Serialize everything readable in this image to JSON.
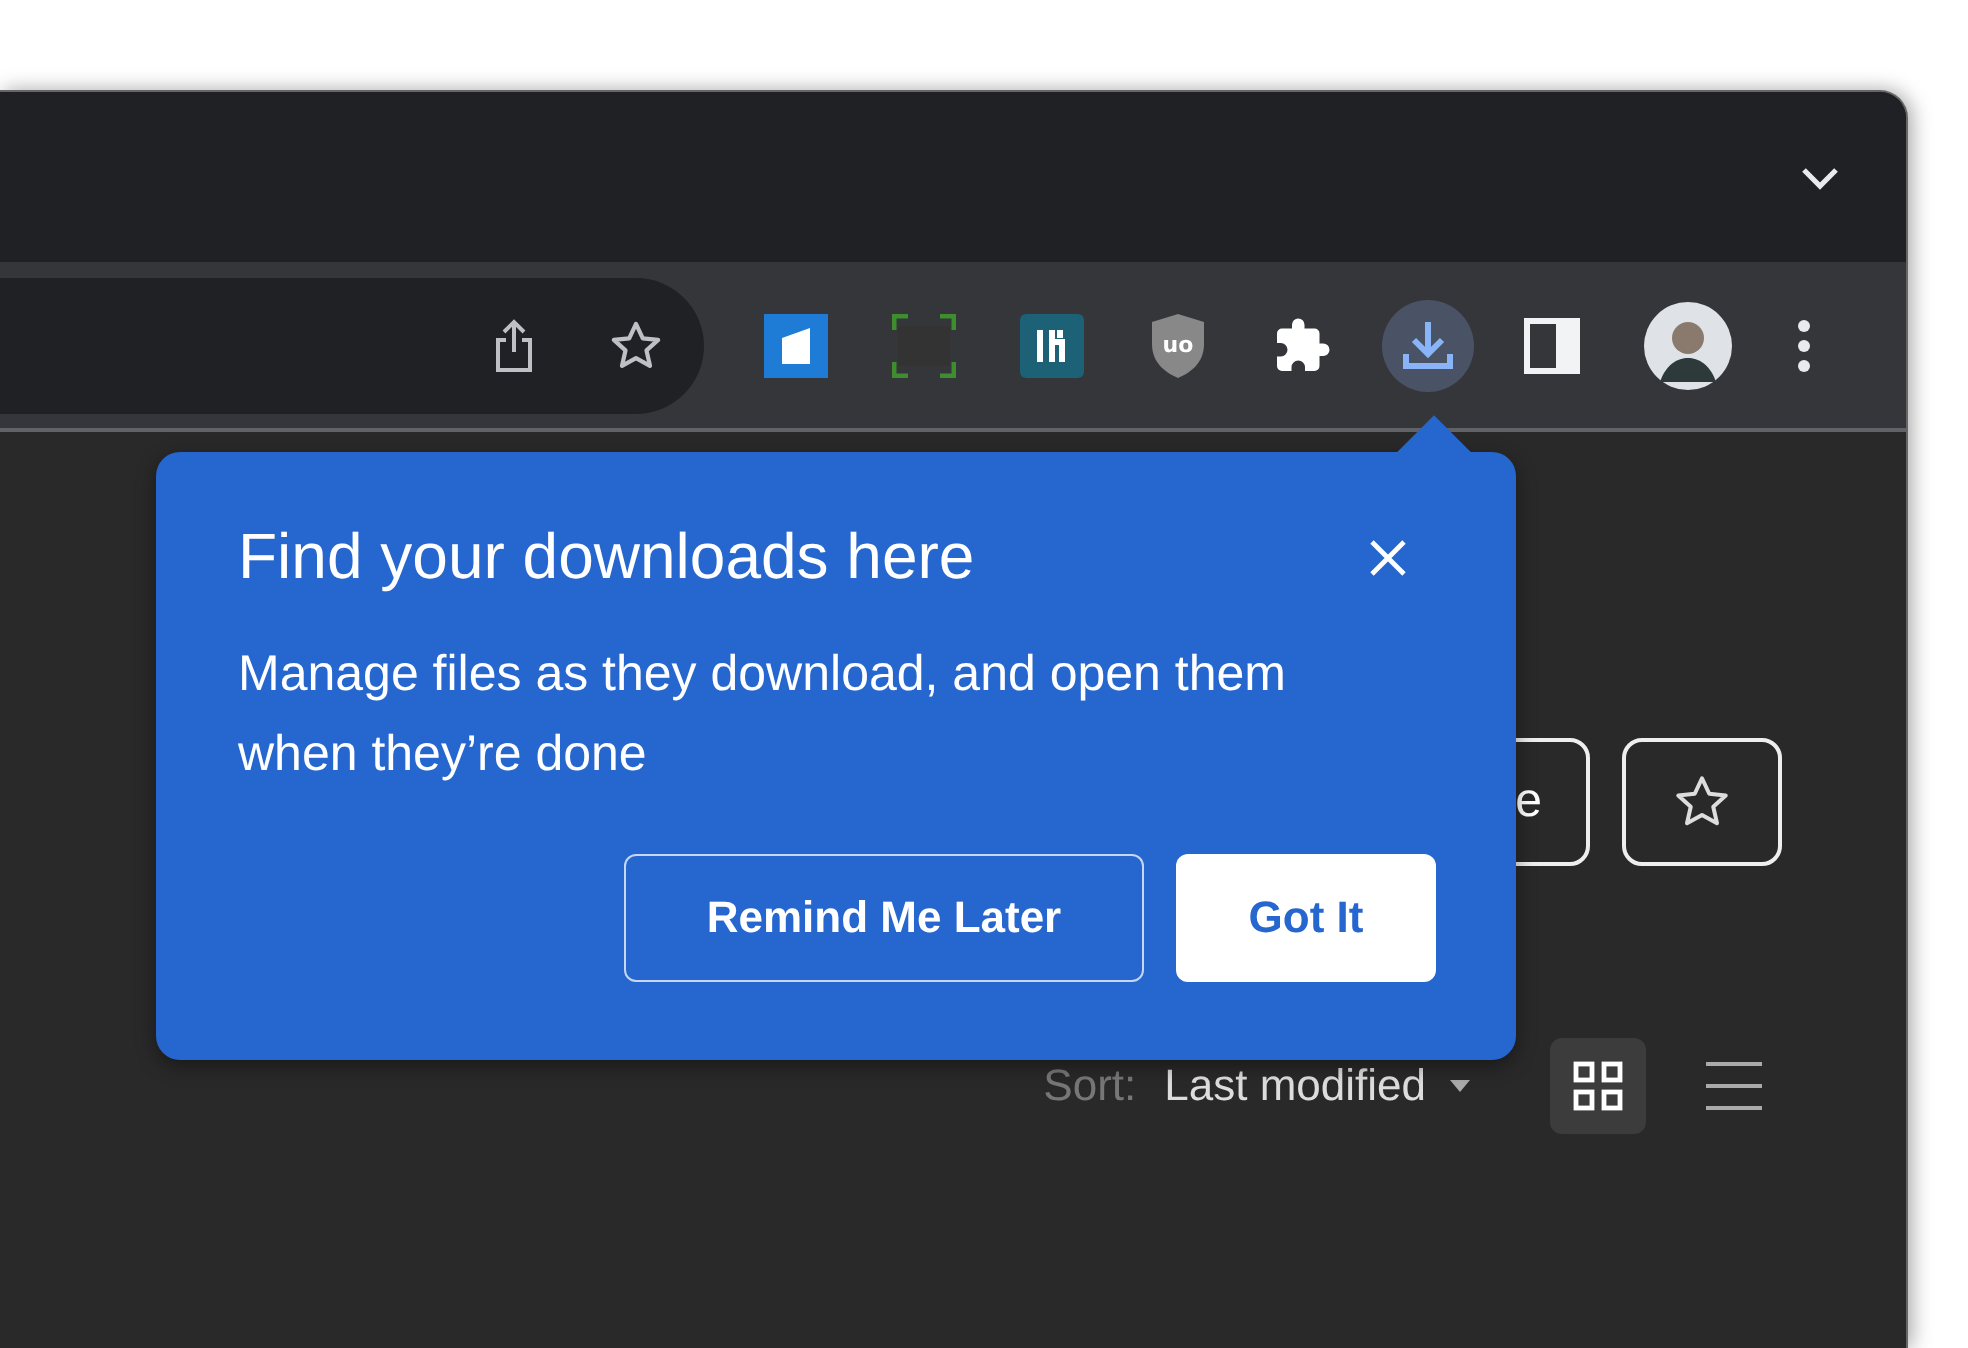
{
  "toolbar": {
    "shield_label": "uo",
    "download_button": {
      "highlighted": true
    }
  },
  "popup": {
    "title": "Find your downloads here",
    "body": "Manage files as they download, and open them when they’re done",
    "buttons": [
      {
        "label": "Remind Me Later",
        "kind": "outlined"
      },
      {
        "label": "Got It",
        "kind": "filled"
      }
    ]
  },
  "page": {
    "partial_button": "e",
    "sort_label": "Sort:",
    "sort_value": "Last modified",
    "views": [
      {
        "kind": "grid",
        "selected": true
      },
      {
        "kind": "list",
        "selected": false
      }
    ]
  }
}
